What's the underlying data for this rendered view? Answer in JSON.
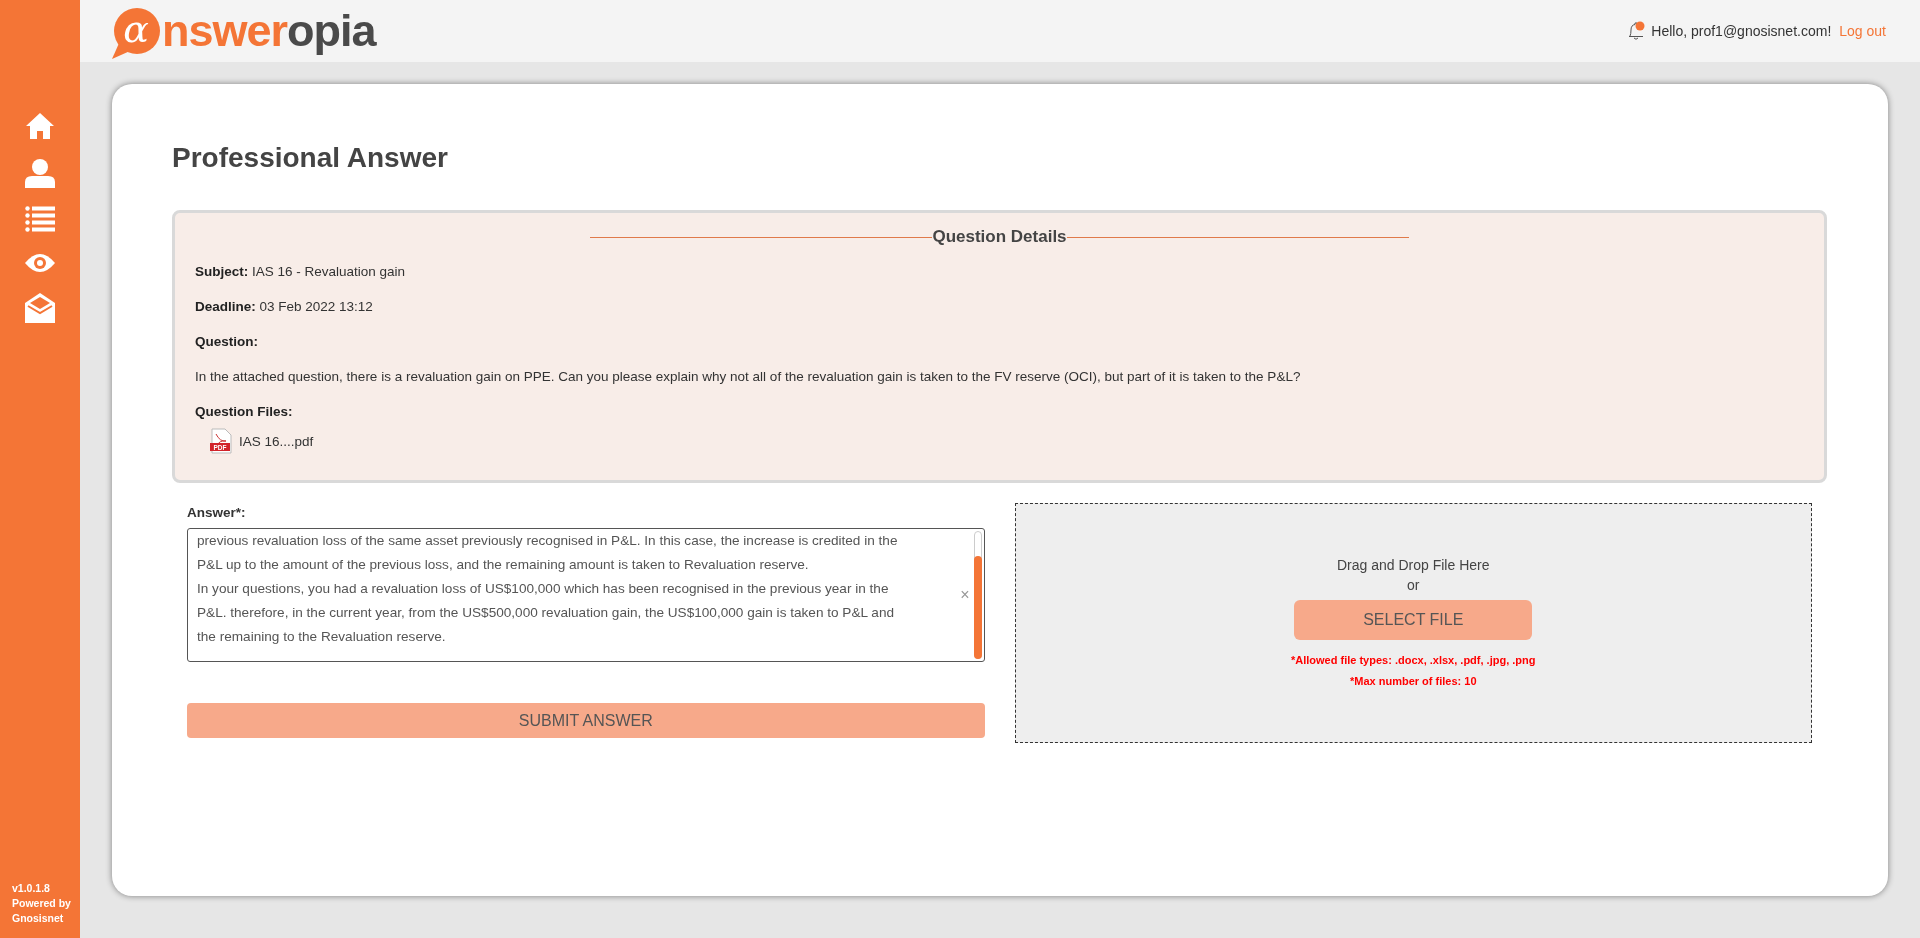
{
  "sidebar": {
    "items": [
      {
        "kind": "home"
      },
      {
        "kind": "user"
      },
      {
        "kind": "list"
      },
      {
        "kind": "eye"
      },
      {
        "kind": "mail"
      }
    ],
    "version": "v1.0.1.8",
    "powered_by": "Powered by Gnosisnet"
  },
  "header": {
    "logo": {
      "mark": "α",
      "part1": "nswer",
      "part2": "opia"
    },
    "notifications": {
      "unread": true
    },
    "greeting": "Hello, prof1@gnosisnet.com!",
    "logout": "Log out"
  },
  "page": {
    "title": "Professional Answer"
  },
  "question_details": {
    "title": "Question Details",
    "fields": [
      {
        "label": "Subject:",
        "value": "IAS 16 - Revaluation gain"
      },
      {
        "label": "Deadline:",
        "value": "03 Feb 2022 13:12"
      }
    ],
    "question_label": "Question:",
    "question": "In the attached question, there is a revaluation gain on PPE. Can you please explain why not all of the revaluation gain is taken to the FV reserve (OCI), but part of it is taken to the P&L?",
    "files_label": "Question Files:",
    "files": [
      {
        "name": "IAS 16....pdf",
        "type_label": "PDF"
      }
    ]
  },
  "answer": {
    "label": "Answer*:",
    "lines": [
      "previous revaluation loss of the same asset previously recognised in P&L. In this case, the increase is credited in the",
      "P&L up to the amount of the previous loss, and the remaining amount is taken to Revaluation reserve.",
      "In your questions, you had a revaluation loss of US$100,000 which has been recognised in the previous year in the",
      "P&L. therefore, in the current year, from the US$500,000 revaluation gain, the US$100,000 gain is taken to P&L and",
      "the remaining to the Revaluation reserve."
    ],
    "clear": "×",
    "submit": "SUBMIT ANSWER"
  },
  "upload": {
    "drop_text": "Drag and Drop File Here",
    "or": "or",
    "button": "SELECT FILE",
    "notes": [
      "*Allowed file types: .docx, .xlsx, .pdf, .jpg, .png",
      "*Max number of files: 10"
    ]
  }
}
